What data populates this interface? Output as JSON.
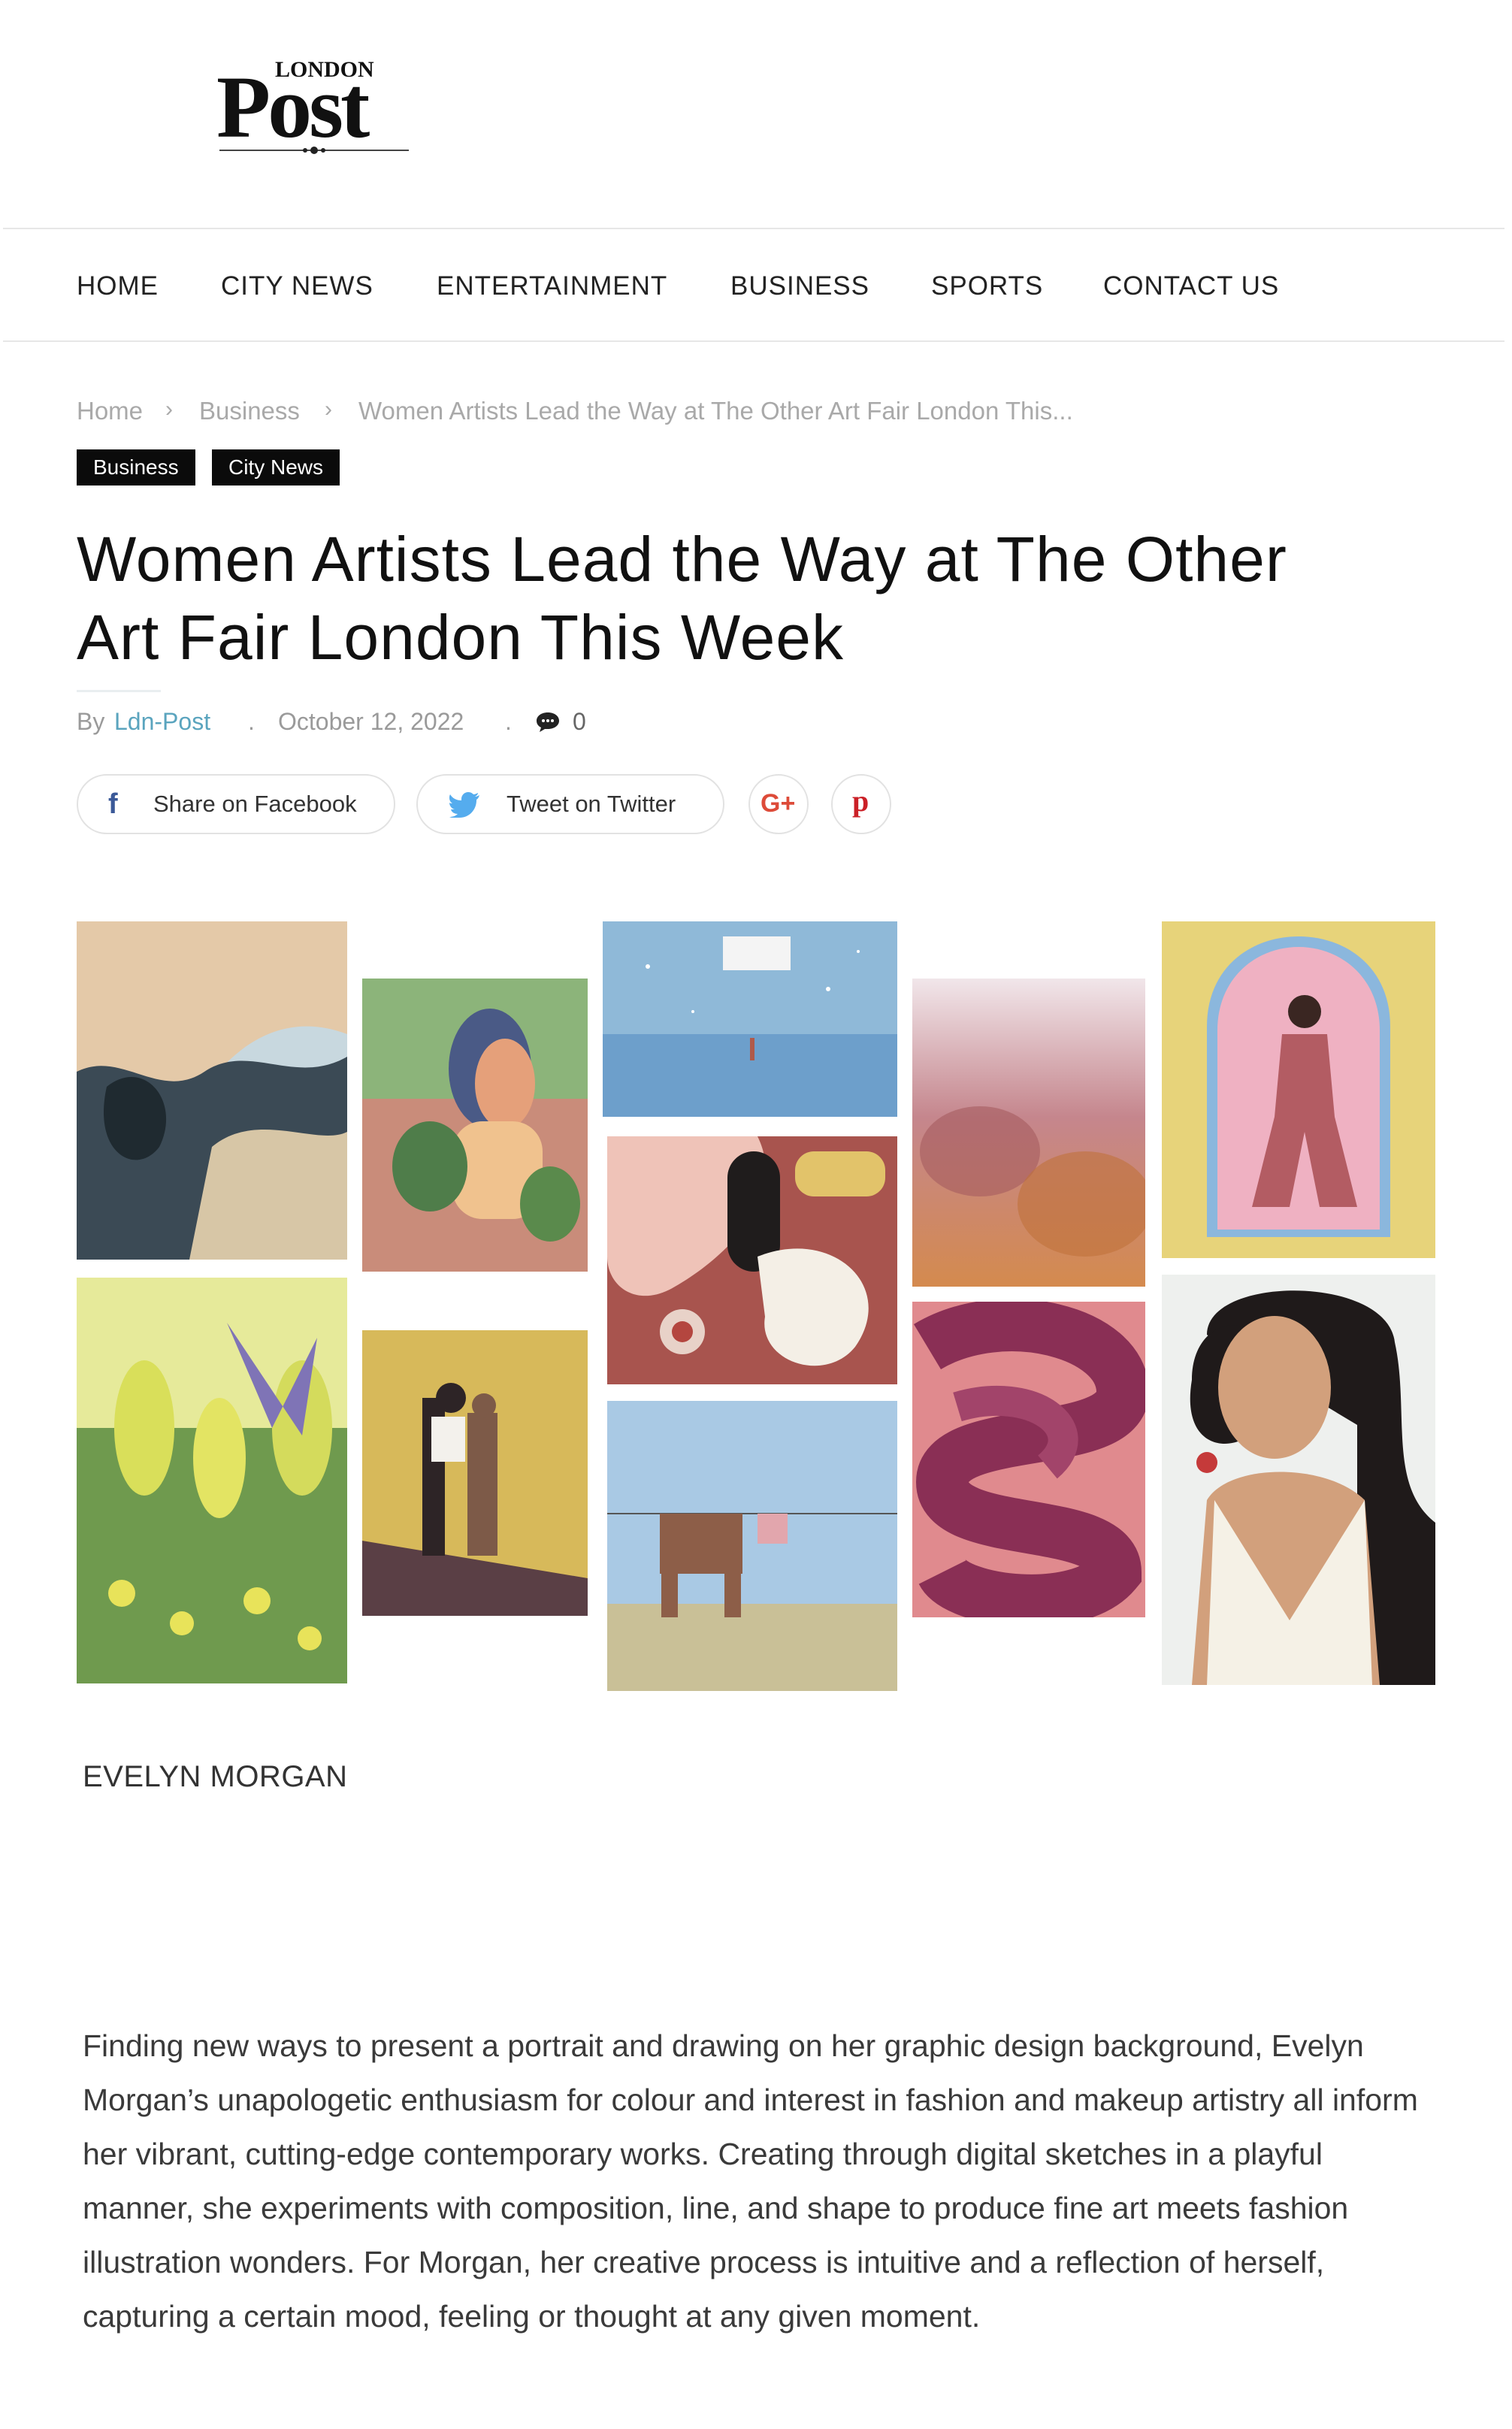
{
  "logo": {
    "top_word": "LONDON",
    "main_word": "Post"
  },
  "nav": {
    "items": [
      "HOME",
      "CITY NEWS",
      "ENTERTAINMENT",
      "BUSINESS",
      "SPORTS",
      "CONTACT US"
    ]
  },
  "breadcrumb": {
    "home": "Home",
    "section": "Business",
    "current": "Women Artists Lead the Way at The Other Art Fair London This...",
    "separator_icon": "chevron-right-icon"
  },
  "tags": [
    "Business",
    "City News"
  ],
  "article": {
    "title_line1": "Women Artists Lead the Way at The Other",
    "title_line2": "Art Fair London This Week",
    "by": "By",
    "author": "Ldn-Post",
    "date": "October 12, 2022",
    "comment_count": "0",
    "caption": "EVELYN MORGAN",
    "body": "Finding new ways to present a portrait and drawing on her graphic design background, Evelyn Morgan’s unapologetic enthusiasm for colour and interest in fashion and makeup artistry all inform her vibrant, cutting-edge contemporary works. Creating through digital sketches in a playful manner, she experiments with composition, line, and shape to produce fine art meets fashion illustration wonders. For Morgan, her creative process is intuitive and a reflection of herself, capturing a certain mood, feeling or thought at any given moment."
  },
  "share": {
    "facebook": "Share on Facebook",
    "twitter": "Tweet on Twitter",
    "google_plus": "G+",
    "pinterest": "p"
  },
  "colors": {
    "accent_link": "#5aa4be",
    "tag_bg": "#0b0b0b",
    "facebook": "#3b5998",
    "twitter": "#55acee",
    "google_plus": "#dd4b39",
    "pinterest": "#cb2027"
  }
}
